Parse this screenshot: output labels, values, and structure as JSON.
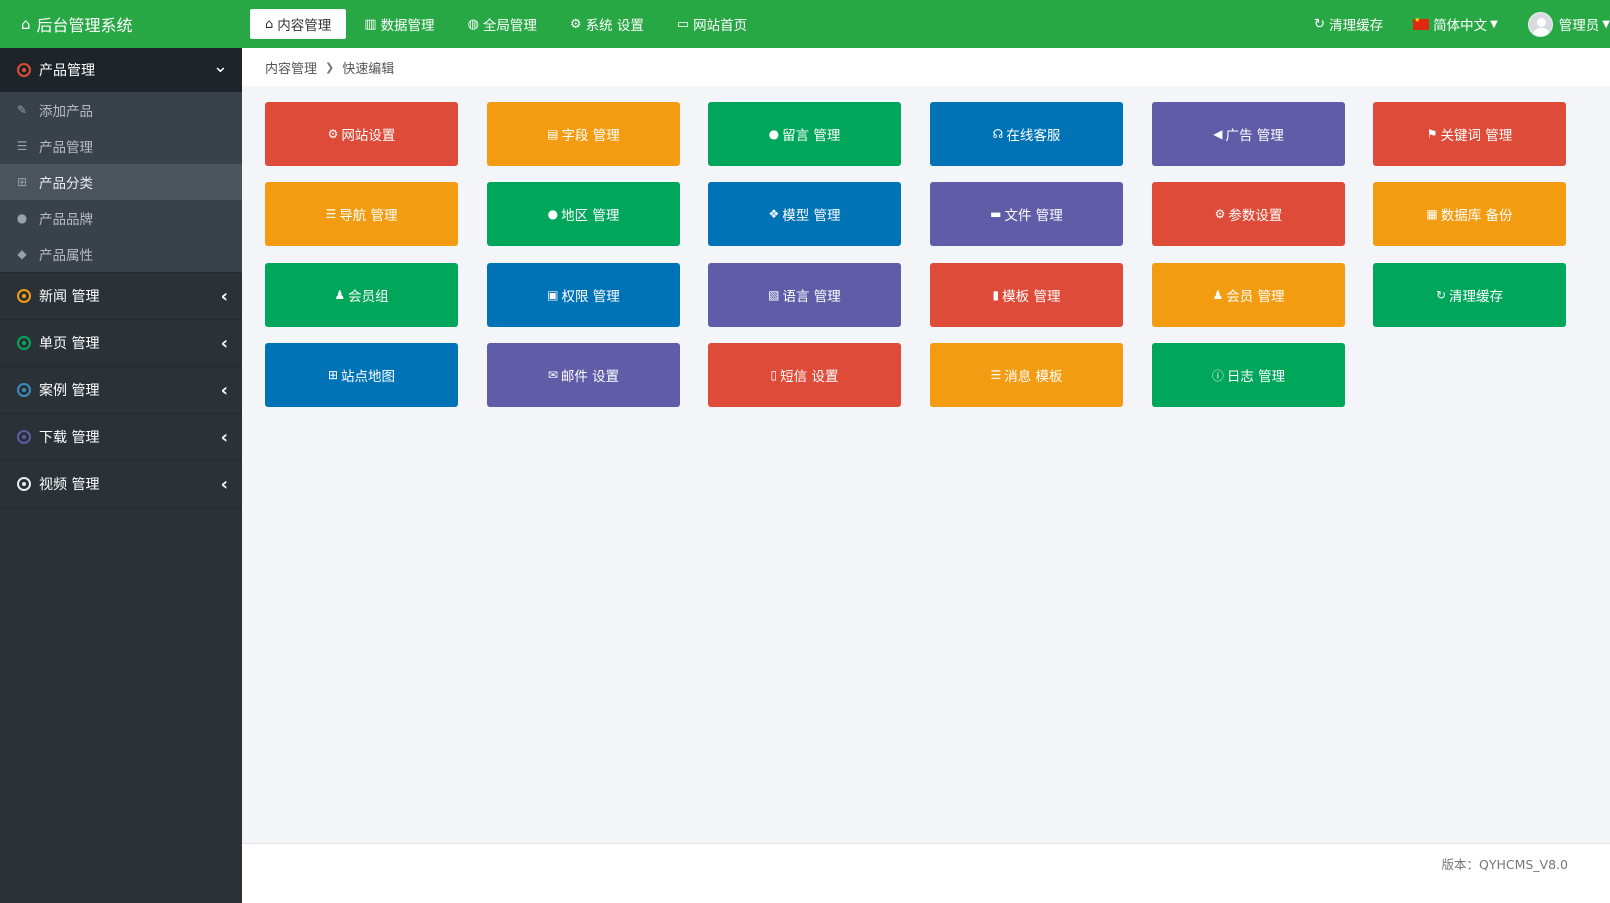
{
  "app": {
    "title": "后台管理系统",
    "icon": "home-icon"
  },
  "topnav": [
    {
      "label": "内容管理",
      "icon": "home-icon",
      "glyph": "⌂",
      "active": true
    },
    {
      "label": "数据管理",
      "icon": "bar-chart-icon",
      "glyph": "▥"
    },
    {
      "label": "全局管理",
      "icon": "globe-icon",
      "glyph": "◍"
    },
    {
      "label": "系统 设置",
      "icon": "cogs-icon",
      "glyph": "⚙"
    },
    {
      "label": "网站首页",
      "icon": "desktop-icon",
      "glyph": "▭"
    }
  ],
  "topright": {
    "clear_cache": "清理缓存",
    "language": "简体中文",
    "user": "管理员"
  },
  "sidebar": {
    "groups": [
      {
        "label": "产品管理",
        "open": true,
        "dot_color": "#dd4b39",
        "items": [
          {
            "label": "添加产品",
            "icon": "edit-icon",
            "glyph": "✎"
          },
          {
            "label": "产品管理",
            "icon": "list-icon",
            "glyph": "☰"
          },
          {
            "label": "产品分类",
            "icon": "sitemap-icon",
            "glyph": "⊞",
            "active": true
          },
          {
            "label": "产品品牌",
            "icon": "lightbulb-icon",
            "glyph": "●"
          },
          {
            "label": "产品属性",
            "icon": "tag-icon",
            "glyph": "◆"
          }
        ]
      },
      {
        "label": "新闻 管理",
        "dot_color": "#f39c12"
      },
      {
        "label": "单页 管理",
        "dot_color": "#00a65a"
      },
      {
        "label": "案例 管理",
        "dot_color": "#3c8dbc"
      },
      {
        "label": "下载 管理",
        "dot_color": "#605ca8"
      },
      {
        "label": "视频 管理",
        "dot_color": "#e8eaec"
      }
    ]
  },
  "breadcrumb": {
    "parent": "内容管理",
    "current": "快速编辑"
  },
  "tiles": [
    {
      "label": "网站设置",
      "icon": "gear-icon",
      "glyph": "⚙",
      "color": "red"
    },
    {
      "label": "字段 管理",
      "icon": "list-alt-icon",
      "glyph": "▤",
      "color": "orange"
    },
    {
      "label": "留言 管理",
      "icon": "comment-icon",
      "glyph": "●",
      "color": "green"
    },
    {
      "label": "在线客服",
      "icon": "headset-icon",
      "glyph": "☊",
      "color": "blue"
    },
    {
      "label": "广告 管理",
      "icon": "bullhorn-icon",
      "glyph": "◀",
      "color": "purple"
    },
    {
      "label": "关键词 管理",
      "icon": "flag-icon",
      "glyph": "⚑",
      "color": "red"
    },
    {
      "label": "导航 管理",
      "icon": "bars-icon",
      "glyph": "☰",
      "color": "orange"
    },
    {
      "label": "地区 管理",
      "icon": "map-marker-icon",
      "glyph": "●",
      "color": "green"
    },
    {
      "label": "模型 管理",
      "icon": "cubes-icon",
      "glyph": "❖",
      "color": "blue"
    },
    {
      "label": "文件 管理",
      "icon": "folder-icon",
      "glyph": "▬",
      "color": "purple"
    },
    {
      "label": "参数设置",
      "icon": "cogs-icon",
      "glyph": "⚙",
      "color": "red"
    },
    {
      "label": "数据库 备份",
      "icon": "database-icon",
      "glyph": "▦",
      "color": "orange"
    },
    {
      "label": "会员组",
      "icon": "users-icon",
      "glyph": "♟",
      "color": "green"
    },
    {
      "label": "权限 管理",
      "icon": "briefcase-icon",
      "glyph": "▣",
      "color": "blue"
    },
    {
      "label": "语言 管理",
      "icon": "language-icon",
      "glyph": "▧",
      "color": "purple"
    },
    {
      "label": "模板 管理",
      "icon": "file-icon",
      "glyph": "▮",
      "color": "red"
    },
    {
      "label": "会员 管理",
      "icon": "user-icon",
      "glyph": "♟",
      "color": "orange"
    },
    {
      "label": "清理缓存",
      "icon": "refresh-icon",
      "glyph": "↻",
      "color": "green"
    },
    {
      "label": "站点地图",
      "icon": "sitemap-icon",
      "glyph": "⊞",
      "color": "blue"
    },
    {
      "label": "邮件 设置",
      "icon": "envelope-icon",
      "glyph": "✉",
      "color": "purple"
    },
    {
      "label": "短信 设置",
      "icon": "mobile-icon",
      "glyph": "▯",
      "color": "red"
    },
    {
      "label": "消息 模板",
      "icon": "list-ul-icon",
      "glyph": "☰",
      "color": "orange"
    },
    {
      "label": "日志 管理",
      "icon": "info-circle-icon",
      "glyph": "ⓘ",
      "color": "green"
    }
  ],
  "footer": {
    "version": "版本：QYHCMS_V8.0"
  }
}
